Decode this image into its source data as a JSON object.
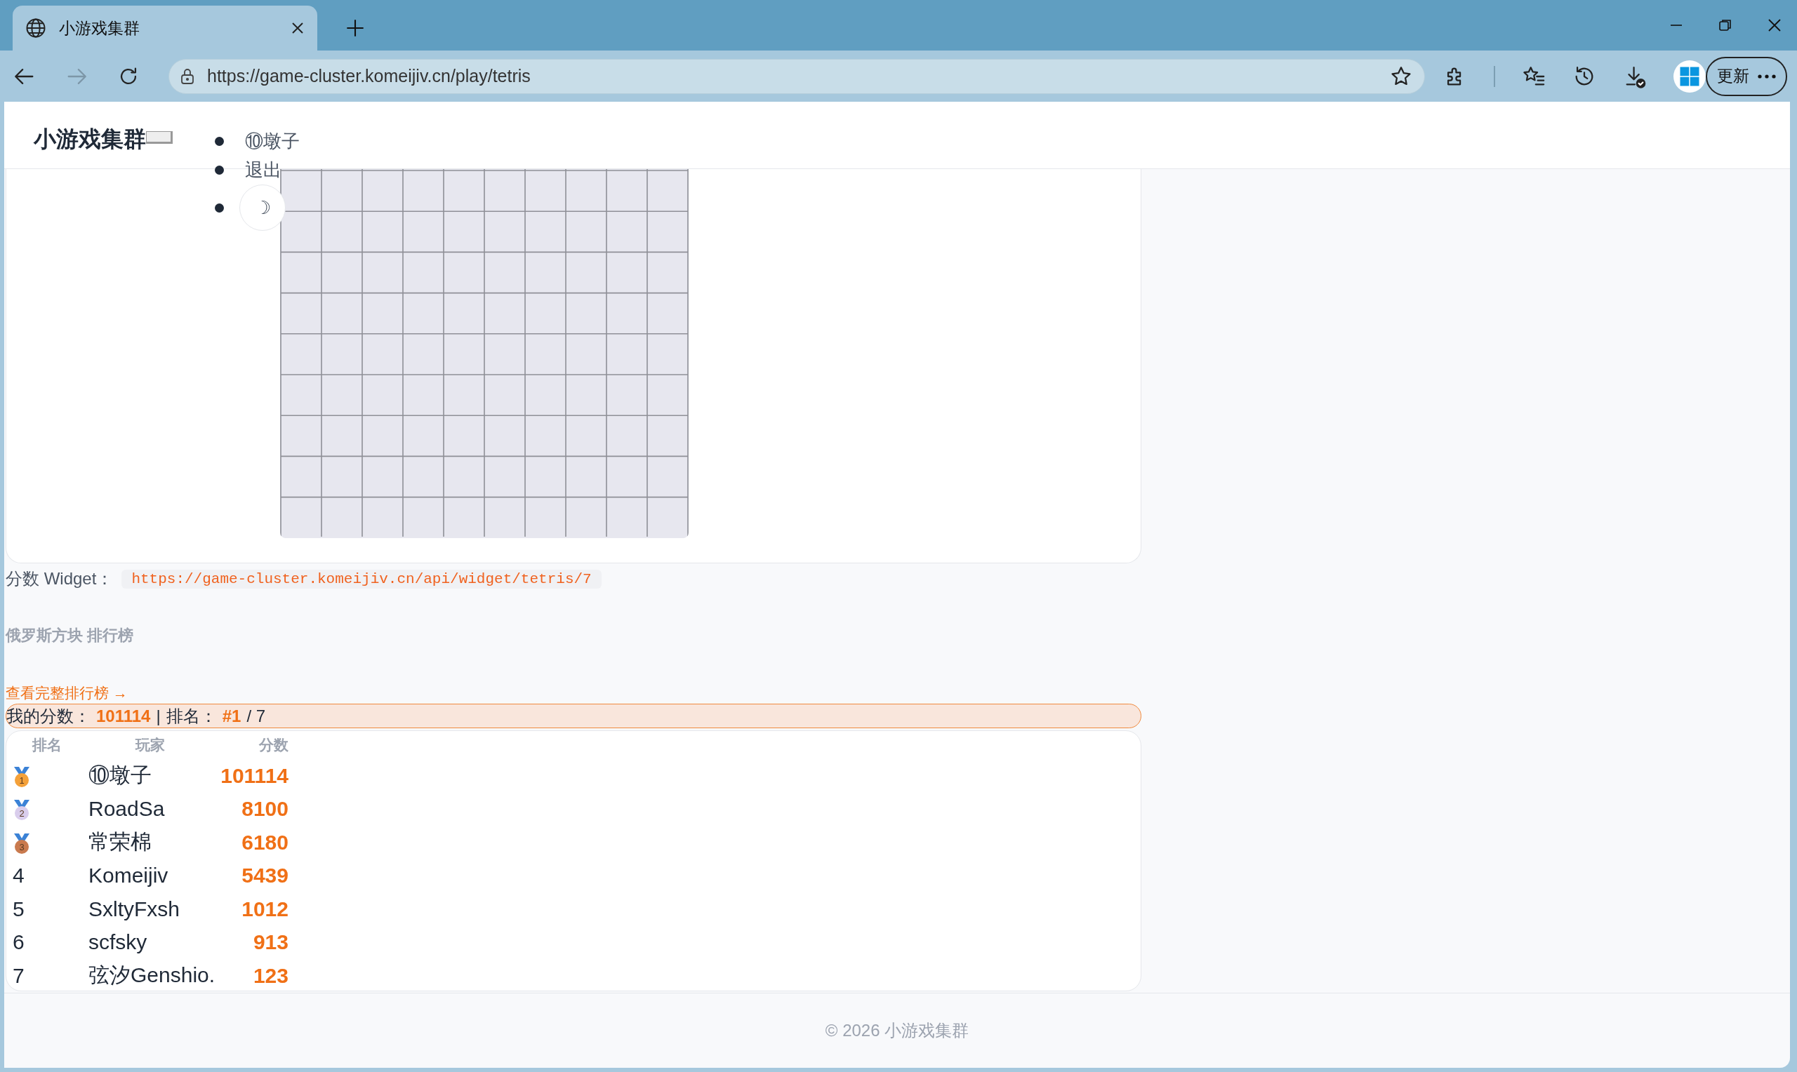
{
  "browser": {
    "tabs": [
      {
        "title": "小游戏集群",
        "selected": true
      }
    ],
    "address": "https://game-cluster.komeijiv.cn/play/tetris",
    "forward_disabled": true,
    "update_button": "更新"
  },
  "header": {
    "logo": "小游戏集群",
    "nav": [
      {
        "kind": "text",
        "label": "⑩墩子"
      },
      {
        "kind": "text",
        "label": "退出"
      },
      {
        "kind": "theme",
        "label": "☽"
      }
    ]
  },
  "widget": {
    "label": "分数 Widget：",
    "url": "https://game-cluster.komeijiv.cn/api/widget/tetris/7"
  },
  "leaderboard": {
    "title": "俄罗斯方块 排行榜",
    "link": "查看完整排行榜 →",
    "my_score": {
      "score_label": "我的分数：",
      "score": "101114",
      "separator": "|",
      "rank_label": "排名：",
      "rank": "#1",
      "total": "/ 7"
    },
    "columns": [
      "排名",
      "玩家",
      "分数"
    ],
    "rows": [
      {
        "kind": "medal",
        "rank": "1",
        "color": "#f4a13a",
        "player": "⑩墩子",
        "score": "101114"
      },
      {
        "kind": "medal",
        "rank": "2",
        "color": "#d9cdec",
        "player": "RoadSa",
        "score": "8100"
      },
      {
        "kind": "medal",
        "rank": "3",
        "color": "#c97a4e",
        "player": "常荣棉",
        "score": "6180"
      },
      {
        "kind": "number",
        "rank": "4",
        "player": "Komeijiv",
        "score": "5439"
      },
      {
        "kind": "number",
        "rank": "5",
        "player": "SxltyFxsh",
        "score": "1012"
      },
      {
        "kind": "number",
        "rank": "6",
        "player": "scfsky",
        "score": "913"
      },
      {
        "kind": "number",
        "rank": "7",
        "player": "弦汐Genshio.",
        "score": "123"
      }
    ]
  },
  "footer": "© 2026 小游戏集群"
}
